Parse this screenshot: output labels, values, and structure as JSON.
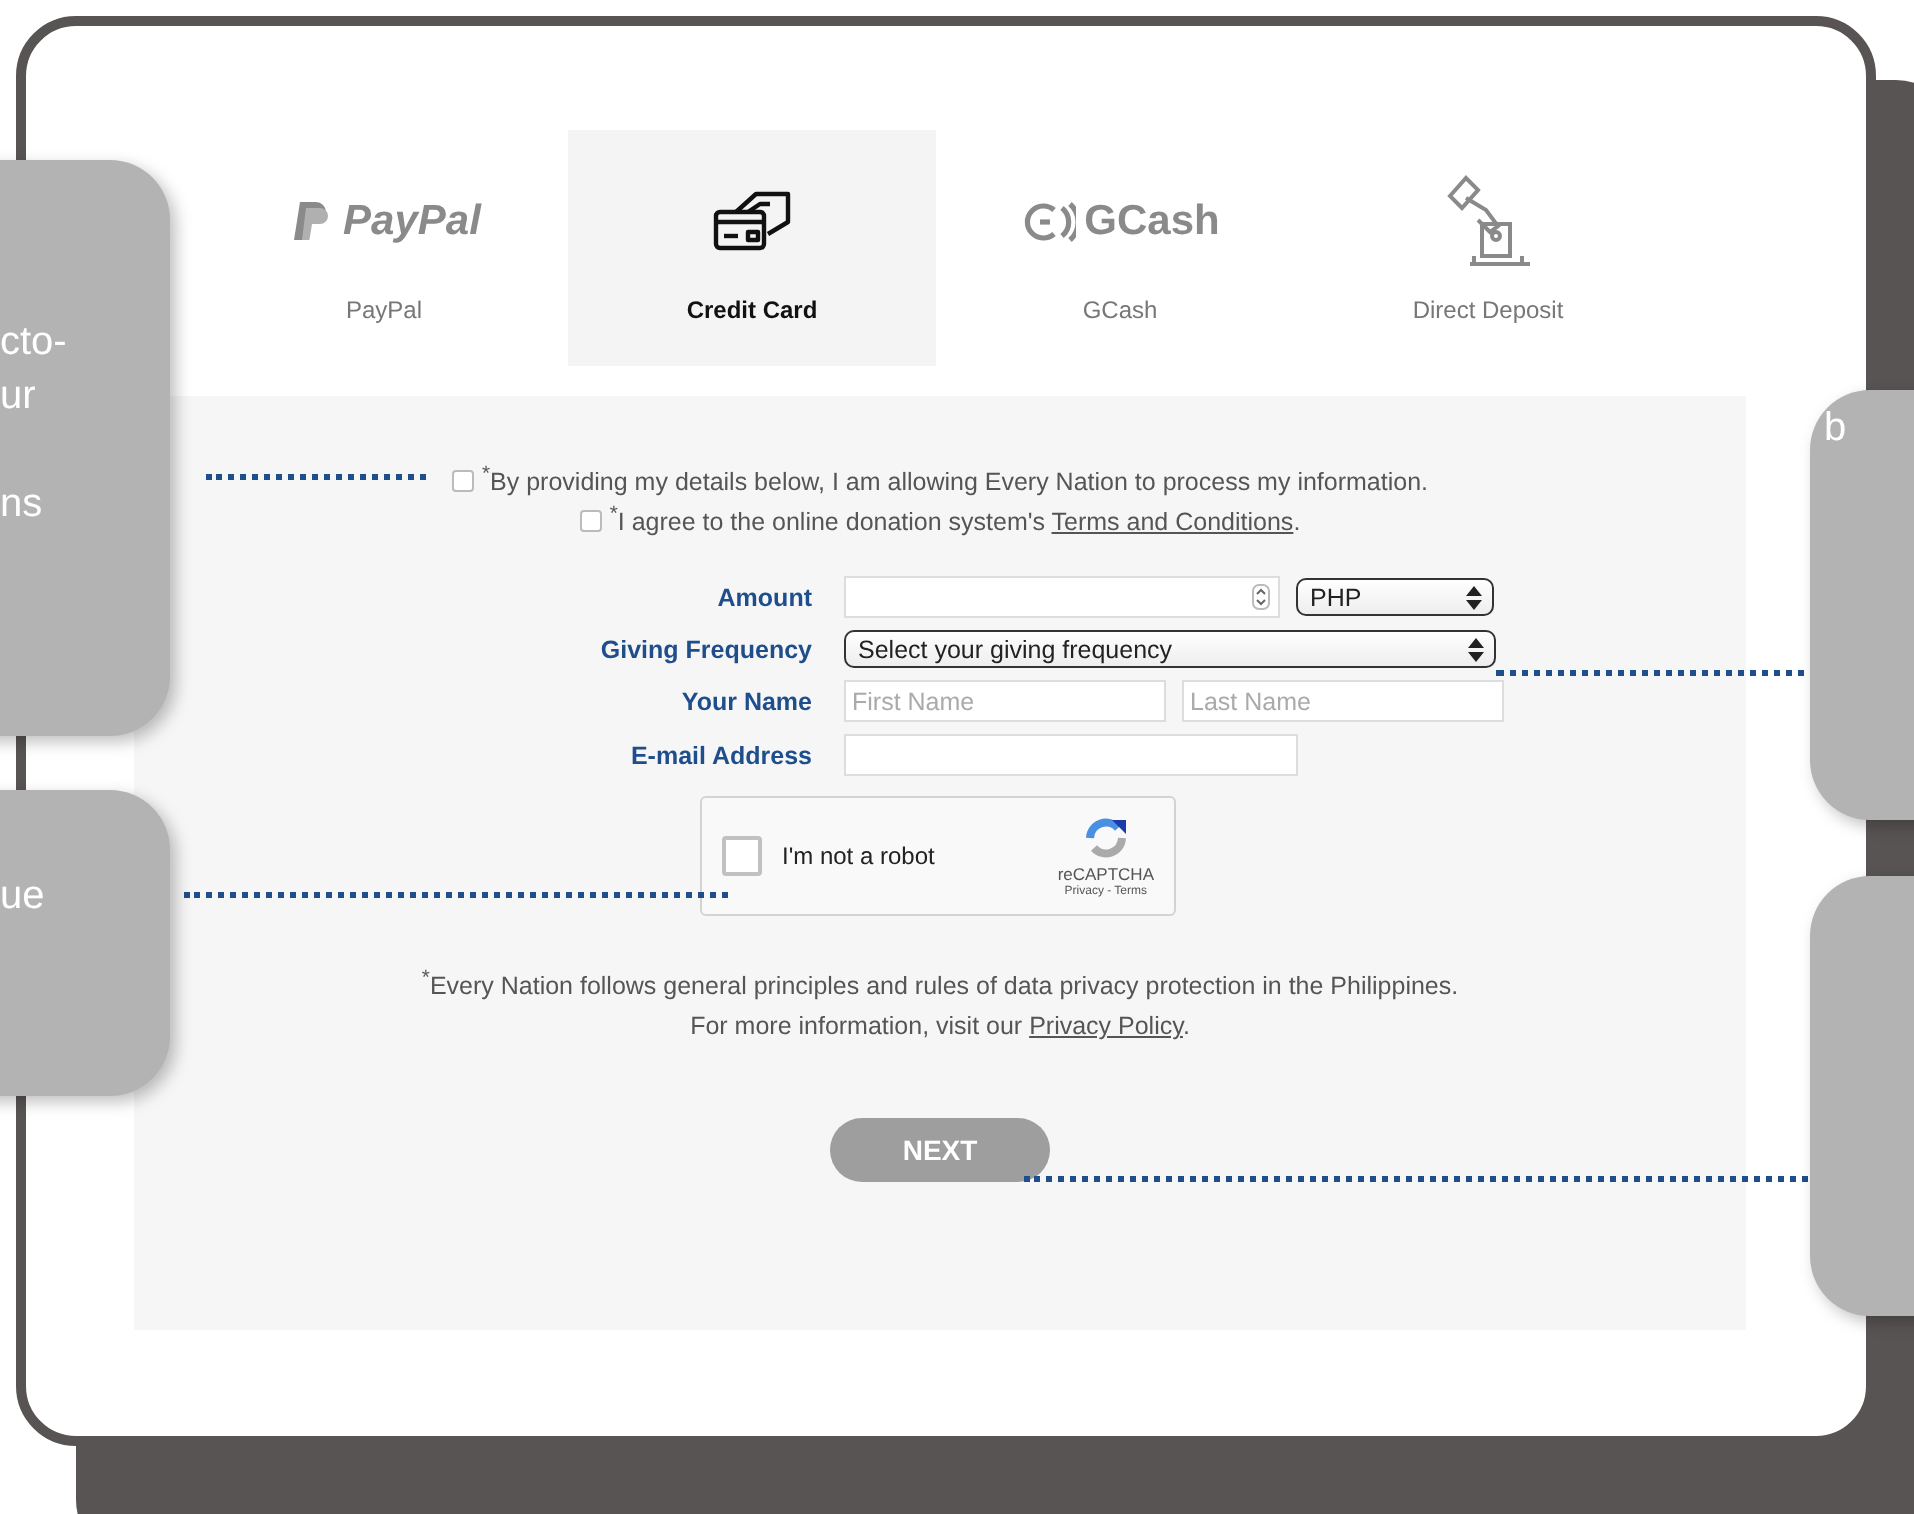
{
  "payment_methods": [
    {
      "kind": "paypal",
      "logo_text": "PayPal",
      "label": "PayPal",
      "selected": false
    },
    {
      "kind": "card",
      "label": "Credit Card",
      "selected": true
    },
    {
      "kind": "gcash",
      "logo_text": "GCash",
      "label": "GCash",
      "selected": false
    },
    {
      "kind": "deposit",
      "label": "Direct Deposit",
      "selected": false
    }
  ],
  "consents": [
    {
      "text": "$^{*}$By providing my details below, I am allowing Every Nation to process my information.",
      "checked": false
    },
    {
      "text": "$^{*}$I agree to the online donation system's ",
      "link": "Terms and Conditions",
      "after": ".",
      "checked": false
    }
  ],
  "form": {
    "amount_label": "Amount",
    "currency": "PHP",
    "frequency_label": "Giving Frequency",
    "frequency": "Select your giving frequency",
    "name_label": "Your Name",
    "first_name_placeholder": "First Name",
    "last_name_placeholder": "Last Name",
    "email_label": "E-mail Address"
  },
  "captcha": {
    "label": "I'm not a robot",
    "brand": "reCAPTCHA",
    "links": "Privacy - Terms",
    "checked": false
  },
  "privacy": {
    "line1": "$^{*}$Every Nation follows general principles and rules of data privacy protection in the Philippines.",
    "line2": "For more information, visit our ",
    "link": "Privacy Policy",
    "after": "."
  },
  "next_button": "NEXT",
  "callouts": [
    {
      "lines": [
        "cto-",
        "ur",
        "ns"
      ]
    },
    {
      "lines": [
        "ue"
      ]
    },
    {
      "lines": [
        "b"
      ]
    }
  ]
}
